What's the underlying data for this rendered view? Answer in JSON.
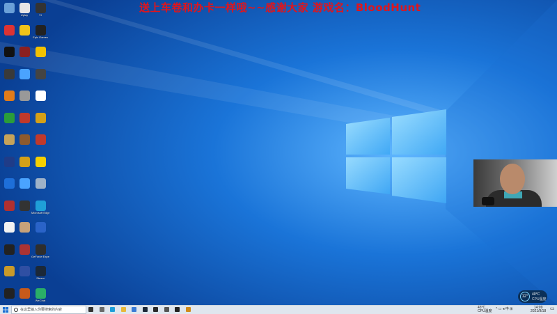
{
  "overlay": {
    "text": "送上车卷和办卡一样哦~~感谢大家 游戏名：BloodHunt"
  },
  "colors": {
    "wallpaper_dark": "#0a4fa8",
    "wallpaper_light": "#2f8fe6",
    "overlay_text": "#e0151c",
    "taskbar": "#dfe6ee"
  },
  "desktop_icons": [
    {
      "name": "recycle-bin-icon",
      "color": "#6aa0d8",
      "label": ""
    },
    {
      "name": "app-icon",
      "color": "#e6e6e6",
      "label": "Uplay"
    },
    {
      "name": "app-icon",
      "color": "#333",
      "label": "VI"
    },
    {
      "name": "app-icon",
      "color": "#d33",
      "label": ""
    },
    {
      "name": "app-icon",
      "color": "#f0c419",
      "label": ""
    },
    {
      "name": "epic-games-icon",
      "color": "#222",
      "label": "Epic Games"
    },
    {
      "name": "qq-icon",
      "color": "#111",
      "label": ""
    },
    {
      "name": "app-icon",
      "color": "#8b2020",
      "label": ""
    },
    {
      "name": "app-icon",
      "color": "#f2c200",
      "label": ""
    },
    {
      "name": "app-icon",
      "color": "#3a3a3a",
      "label": ""
    },
    {
      "name": "app-icon",
      "color": "#4aa3ff",
      "label": ""
    },
    {
      "name": "app-icon",
      "color": "#444",
      "label": ""
    },
    {
      "name": "app-icon",
      "color": "#e07b1a",
      "label": ""
    },
    {
      "name": "app-icon",
      "color": "#999",
      "label": ""
    },
    {
      "name": "app-icon",
      "color": "#fff",
      "label": ""
    },
    {
      "name": "app-icon",
      "color": "#2a9d3a",
      "label": ""
    },
    {
      "name": "app-icon",
      "color": "#c0392b",
      "label": ""
    },
    {
      "name": "app-icon",
      "color": "#d4a017",
      "label": ""
    },
    {
      "name": "app-icon",
      "color": "#c6a35a",
      "label": ""
    },
    {
      "name": "app-icon",
      "color": "#8e5a2e",
      "label": ""
    },
    {
      "name": "app-icon",
      "color": "#c0392b",
      "label": ""
    },
    {
      "name": "app-icon",
      "color": "#1f3c88",
      "label": ""
    },
    {
      "name": "app-icon",
      "color": "#d4a017",
      "label": ""
    },
    {
      "name": "app-icon",
      "color": "#f5d000",
      "label": ""
    },
    {
      "name": "app-icon",
      "color": "#1e6fd9",
      "label": ""
    },
    {
      "name": "app-icon",
      "color": "#4aa3ff",
      "label": ""
    },
    {
      "name": "app-icon",
      "color": "#9fb2c8",
      "label": ""
    },
    {
      "name": "app-icon",
      "color": "#b03030",
      "label": ""
    },
    {
      "name": "app-icon",
      "color": "#333",
      "label": ""
    },
    {
      "name": "edge-icon",
      "color": "#1f9fd8",
      "label": "Microsoft Edge"
    },
    {
      "name": "file-icon",
      "color": "#f2f2f2",
      "label": ""
    },
    {
      "name": "app-icon",
      "color": "#c7a27a",
      "label": ""
    },
    {
      "name": "app-icon",
      "color": "#2a63c8",
      "label": ""
    },
    {
      "name": "app-icon",
      "color": "#222",
      "label": ""
    },
    {
      "name": "app-icon",
      "color": "#a33",
      "label": ""
    },
    {
      "name": "nvidia-icon",
      "color": "#2e2e2e",
      "label": "GeForce Experience"
    },
    {
      "name": "app-icon",
      "color": "#c99a2a",
      "label": ""
    },
    {
      "name": "app-icon",
      "color": "#2f4fa3",
      "label": ""
    },
    {
      "name": "steam-icon",
      "color": "#1b2838",
      "label": "Steam"
    },
    {
      "name": "app-icon",
      "color": "#222",
      "label": ""
    },
    {
      "name": "app-icon",
      "color": "#c85a1a",
      "label": ""
    },
    {
      "name": "wechat-icon",
      "color": "#2aae67",
      "label": "WeChat"
    },
    {
      "name": "file-icon",
      "color": "#f2f2f2",
      "label": ""
    },
    {
      "name": "app-icon",
      "color": "#c03050",
      "label": ""
    }
  ],
  "webcam": {
    "label": "webcam-overlay"
  },
  "widget": {
    "temp": "12°",
    "line1": "40°C",
    "line2": "CPU温度"
  },
  "taskbar": {
    "search_placeholder": "在这里输入你要搜索的内容",
    "apps": [
      {
        "name": "task-view-icon",
        "color": "#333"
      },
      {
        "name": "app-icon",
        "color": "#6a6a6a"
      },
      {
        "name": "edge-icon",
        "color": "#1f9fd8"
      },
      {
        "name": "folder-icon",
        "color": "#e8b83a"
      },
      {
        "name": "store-icon",
        "color": "#3a7bd5"
      },
      {
        "name": "steam-icon",
        "color": "#1b2838"
      },
      {
        "name": "app-icon",
        "color": "#2a2a2a"
      },
      {
        "name": "app-icon",
        "color": "#555"
      },
      {
        "name": "obs-icon",
        "color": "#222"
      },
      {
        "name": "app-icon",
        "color": "#d08a1a"
      }
    ],
    "tray_weather": "43°C",
    "tray_weather2": "CPU温度",
    "clock_time": "14:09",
    "clock_date": "2021/9/18"
  }
}
